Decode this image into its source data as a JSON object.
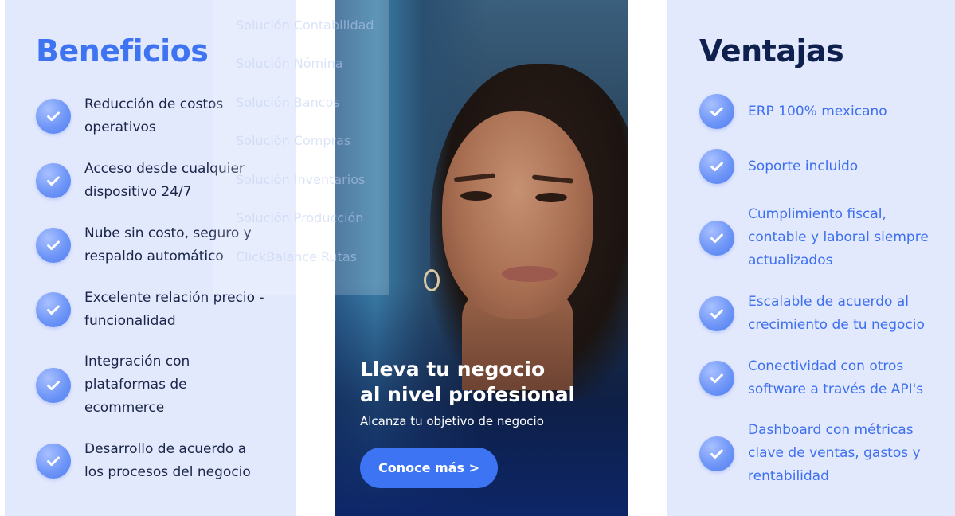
{
  "beneficios": {
    "title": "Beneficios",
    "items": [
      {
        "line1": "Reducción de costos",
        "line2": "operativos"
      },
      {
        "line1": "Acceso desde cualquier",
        "line2": "dispositivo 24/7"
      },
      {
        "line1": "Nube sin costo, seguro y",
        "line2": "respaldo automático"
      },
      {
        "line1": "Excelente relación precio -",
        "line2": "funcionalidad"
      },
      {
        "line1": "Integración con",
        "line2": "plataformas de",
        "line3": "ecommerce"
      },
      {
        "line1": "Desarrollo de acuerdo a",
        "line2": "los procesos del negocio"
      }
    ]
  },
  "menu": {
    "items": [
      "Solución Contabilidad",
      "Solución Nómina",
      "Solución Bancos",
      "Solución Compras",
      "Solución Inventarios",
      "Solución Producción",
      "ClickBalance Rutas"
    ]
  },
  "hero": {
    "title_line1": "Lleva tu negocio",
    "title_line2": "al nivel profesional",
    "subtitle": "Alcanza tu objetivo de negocio",
    "cta_label": "Conoce más >"
  },
  "ventajas": {
    "title": "Ventajas",
    "items": [
      {
        "line1": "ERP 100% mexicano"
      },
      {
        "line1": "Soporte incluido"
      },
      {
        "line1": "Cumplimiento fiscal,",
        "line2": "contable y laboral siempre",
        "line3": "actualizados"
      },
      {
        "line1": "Escalable de acuerdo al",
        "line2": "crecimiento de tu negocio"
      },
      {
        "line1": "Conectividad con otros",
        "line2": "software a través de API's"
      },
      {
        "line1": "Dashboard con métricas",
        "line2": "clave de ventas, gastos y",
        "line3": "rentabilidad"
      }
    ]
  },
  "colors": {
    "accent": "#3c74f3",
    "panel_bg": "#e3e9fd",
    "heading_blue": "#3e73f2",
    "heading_dark": "#0f1f4e"
  },
  "icons": {
    "check": "check-circle-icon"
  }
}
